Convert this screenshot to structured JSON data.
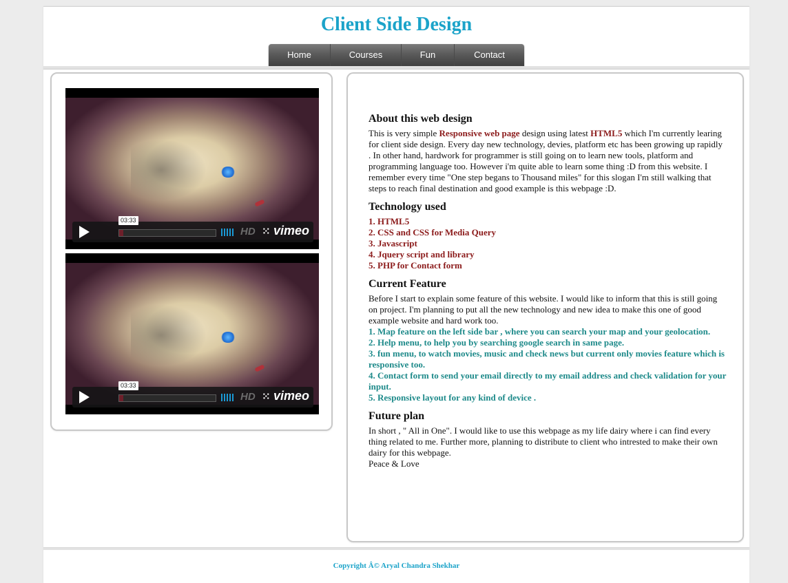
{
  "site": {
    "title": "Client Side Design"
  },
  "nav": {
    "items": [
      "Home",
      "Courses",
      "Fun",
      "Contact"
    ]
  },
  "videos": [
    {
      "timecode": "03:33",
      "hd": "HD",
      "fullscreen": "⁙",
      "brand": "vimeo",
      "progress": 0.04
    },
    {
      "timecode": "03:33",
      "hd": "HD",
      "fullscreen": "⁙",
      "brand": "vimeo",
      "progress": 0.04
    }
  ],
  "about": {
    "heading": "About this web design",
    "t1": "This is very simple ",
    "hl1": "Responsive web page",
    "t2": " design using latest ",
    "hl2": "HTML5",
    "t3": " which I'm currently learing for client side design. Every day new technology, devies, platform etc has been growing up rapidly . In other hand, hardwork for programmer is still going on to learn new tools, platform and programming language too. However i'm quite able to learn some thing :D from this website. I remember every time \"One step begans to Thousand miles\" for this slogan I'm still walking that steps to reach final destination and good example is this webpage :D."
  },
  "technology": {
    "heading": "Technology used",
    "items": [
      "1. HTML5",
      "2. CSS and CSS for Media Query",
      "3. Javascript",
      "4. Jquery script and library",
      "5. PHP for Contact form"
    ]
  },
  "features": {
    "heading": "Current Feature",
    "intro": "Before I start to explain some feature of this website. I would like to inform that this is still going on project. I'm planning to put all the new technology and new idea to make this one of good example website and hard work too.",
    "items": [
      "1. Map feature on the left side bar , where you can search your map and your geolocation.",
      "2. Help menu, to help you by searching google search in same page.",
      "3. fun menu, to watch movies, music and check news but current only movies feature which is responsive too.",
      "4. Contact form to send your email directly to my email address and check validation for your input.",
      "5. Responsive layout for any kind of device ."
    ]
  },
  "future": {
    "heading": "Future plan",
    "body": "In short , \" All in One\". I would like to use this webpage as my life dairy where i can find every thing related to me. Further more, planning to distribute to client who intrested to make their own dairy for this webpage.",
    "signoff": "Peace & Love"
  },
  "footer": {
    "text": "Copyright Â© Aryal Chandra Shekhar"
  },
  "colors": {
    "title": "#1ba3c9",
    "highlight": "#8b1a1a",
    "feature": "#1e8a8a",
    "nav_bg": "#5a5a5a"
  }
}
